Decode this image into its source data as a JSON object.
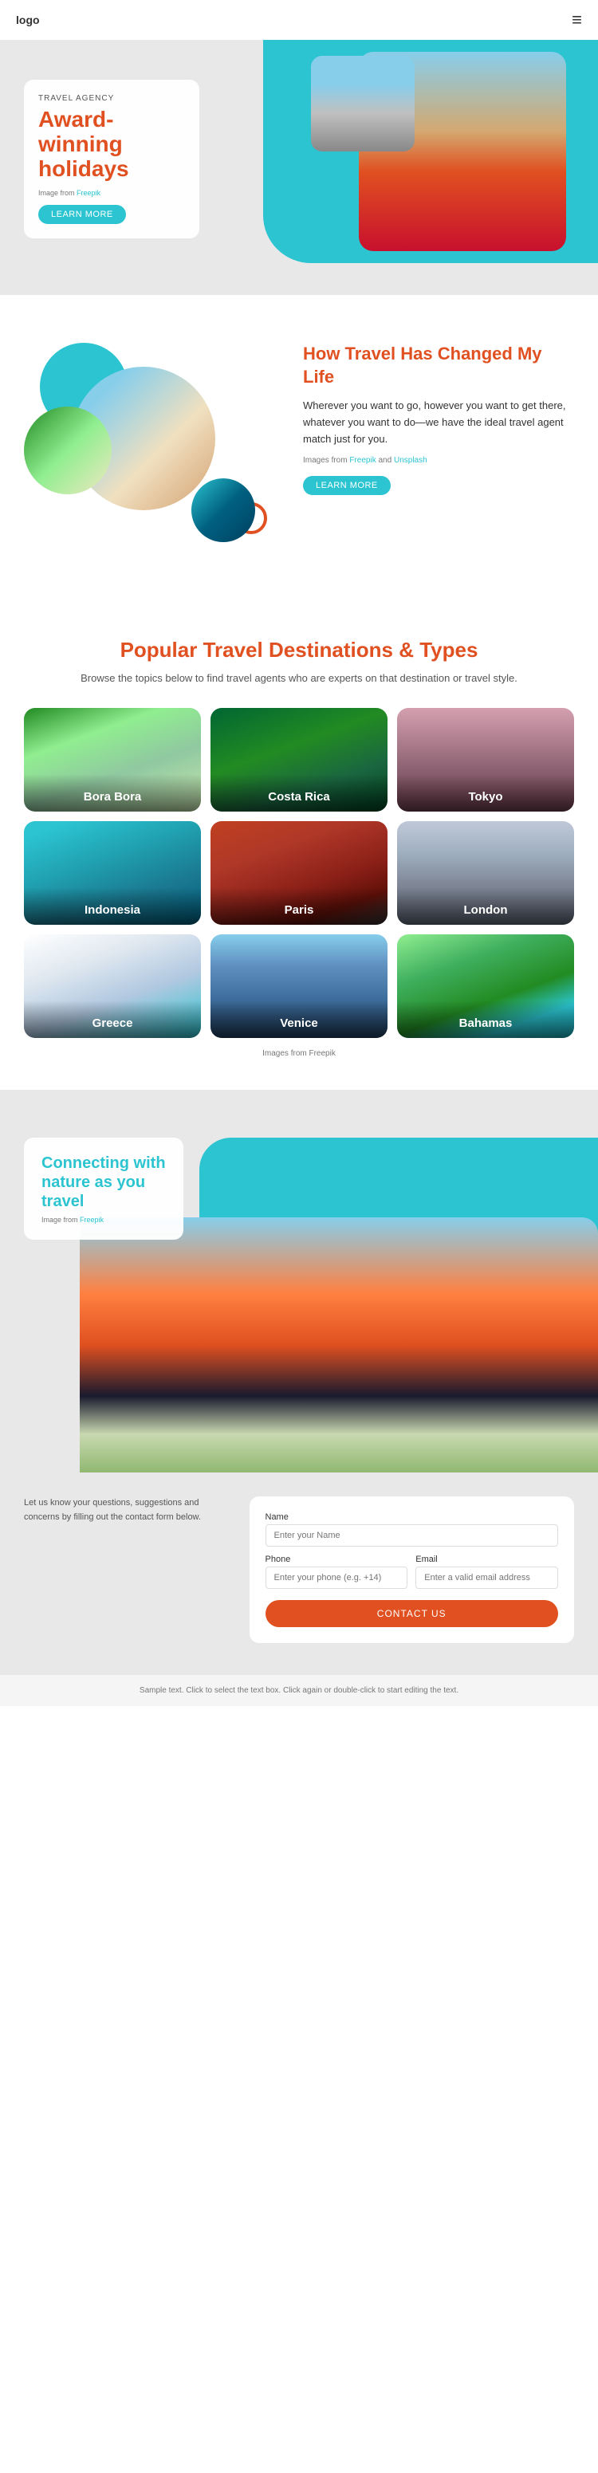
{
  "header": {
    "logo": "logo",
    "hamburger_icon": "≡"
  },
  "hero": {
    "tag": "TRAVEL AGENCY",
    "title": "Award-winning holidays",
    "source_text": "Image from ",
    "source_link": "Freepik",
    "learn_more": "LEARN MORE"
  },
  "how_travel": {
    "title": "How Travel Has Changed My Life",
    "description": "Wherever you want to go, however you want to get there, whatever you want to do—we have the ideal travel agent match just for you.",
    "source_text": "Images from ",
    "source_link1": "Freepik",
    "source_and": " and ",
    "source_link2": "Unsplash",
    "learn_more": "LEARN MORE"
  },
  "destinations": {
    "title": "Popular Travel Destinations & Types",
    "subtitle": "Browse the topics below to find travel agents who are experts on that destination or travel style.",
    "cards": [
      {
        "label": "Bora Bora",
        "class": "dest-borabora"
      },
      {
        "label": "Costa Rica",
        "class": "dest-costarica"
      },
      {
        "label": "Tokyo",
        "class": "dest-tokyo"
      },
      {
        "label": "Indonesia",
        "class": "dest-indonesia"
      },
      {
        "label": "Paris",
        "class": "dest-paris"
      },
      {
        "label": "London",
        "class": "dest-london"
      },
      {
        "label": "Greece",
        "class": "dest-greece"
      },
      {
        "label": "Venice",
        "class": "dest-venice"
      },
      {
        "label": "Bahamas",
        "class": "dest-bahamas"
      }
    ],
    "source_text": "Images from Freepik"
  },
  "connecting": {
    "title": "Connecting with nature as you travel",
    "source_text": "Image from ",
    "source_link": "Freepik"
  },
  "contact": {
    "left_text": "Let us know your questions, suggestions and concerns by filling out the contact form below.",
    "name_label": "Name",
    "name_placeholder": "Enter your Name",
    "phone_label": "Phone",
    "phone_placeholder": "Enter your phone (e.g. +14)",
    "email_label": "Email",
    "email_placeholder": "Enter a valid email address",
    "button": "CONTACT US"
  },
  "footer": {
    "note": "Sample text. Click to select the text box. Click again or double-click to start editing the text."
  }
}
